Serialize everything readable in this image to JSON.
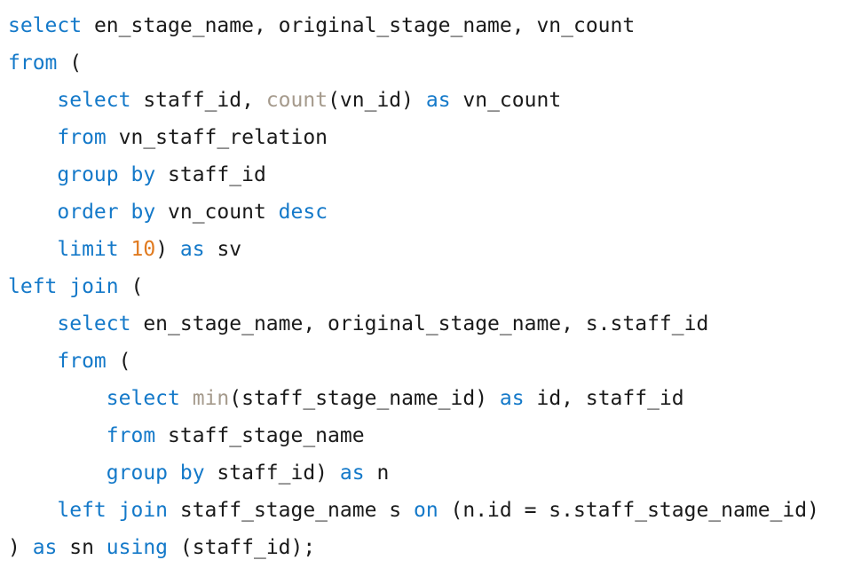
{
  "editor": {
    "lines": [
      [
        {
          "t": "select",
          "k": "keyword"
        },
        {
          "t": " en_stage_name, original_stage_name, vn_count",
          "k": "plain"
        }
      ],
      [
        {
          "t": "from",
          "k": "keyword"
        },
        {
          "t": " (",
          "k": "plain"
        }
      ],
      [
        {
          "t": "    ",
          "k": "plain"
        },
        {
          "t": "select",
          "k": "keyword"
        },
        {
          "t": " staff_id, ",
          "k": "plain"
        },
        {
          "t": "count",
          "k": "func"
        },
        {
          "t": "(vn_id) ",
          "k": "plain"
        },
        {
          "t": "as",
          "k": "keyword"
        },
        {
          "t": " vn_count",
          "k": "plain"
        }
      ],
      [
        {
          "t": "    ",
          "k": "plain"
        },
        {
          "t": "from",
          "k": "keyword"
        },
        {
          "t": " vn_staff_relation",
          "k": "plain"
        }
      ],
      [
        {
          "t": "    ",
          "k": "plain"
        },
        {
          "t": "group by",
          "k": "keyword"
        },
        {
          "t": " staff_id",
          "k": "plain"
        }
      ],
      [
        {
          "t": "    ",
          "k": "plain"
        },
        {
          "t": "order by",
          "k": "keyword"
        },
        {
          "t": " vn_count ",
          "k": "plain"
        },
        {
          "t": "desc",
          "k": "keyword"
        }
      ],
      [
        {
          "t": "    ",
          "k": "plain"
        },
        {
          "t": "limit",
          "k": "keyword"
        },
        {
          "t": " ",
          "k": "plain"
        },
        {
          "t": "10",
          "k": "number"
        },
        {
          "t": ") ",
          "k": "plain"
        },
        {
          "t": "as",
          "k": "keyword"
        },
        {
          "t": " sv",
          "k": "plain"
        }
      ],
      [
        {
          "t": "left join",
          "k": "keyword"
        },
        {
          "t": " (",
          "k": "plain"
        }
      ],
      [
        {
          "t": "    ",
          "k": "plain"
        },
        {
          "t": "select",
          "k": "keyword"
        },
        {
          "t": " en_stage_name, original_stage_name, s.staff_id",
          "k": "plain"
        }
      ],
      [
        {
          "t": "    ",
          "k": "plain"
        },
        {
          "t": "from",
          "k": "keyword"
        },
        {
          "t": " (",
          "k": "plain"
        }
      ],
      [
        {
          "t": "        ",
          "k": "plain"
        },
        {
          "t": "select",
          "k": "keyword"
        },
        {
          "t": " ",
          "k": "plain"
        },
        {
          "t": "min",
          "k": "func"
        },
        {
          "t": "(staff_stage_name_id) ",
          "k": "plain"
        },
        {
          "t": "as",
          "k": "keyword"
        },
        {
          "t": " id, staff_id",
          "k": "plain"
        }
      ],
      [
        {
          "t": "        ",
          "k": "plain"
        },
        {
          "t": "from",
          "k": "keyword"
        },
        {
          "t": " staff_stage_name",
          "k": "plain"
        }
      ],
      [
        {
          "t": "        ",
          "k": "plain"
        },
        {
          "t": "group by",
          "k": "keyword"
        },
        {
          "t": " staff_id) ",
          "k": "plain"
        },
        {
          "t": "as",
          "k": "keyword"
        },
        {
          "t": " n",
          "k": "plain"
        }
      ],
      [
        {
          "t": "    ",
          "k": "plain"
        },
        {
          "t": "left join",
          "k": "keyword"
        },
        {
          "t": " staff_stage_name s ",
          "k": "plain"
        },
        {
          "t": "on",
          "k": "keyword"
        },
        {
          "t": " (n.id = s.staff_stage_name_id)",
          "k": "plain"
        }
      ],
      [
        {
          "t": ") ",
          "k": "plain"
        },
        {
          "t": "as",
          "k": "keyword"
        },
        {
          "t": " sn ",
          "k": "plain"
        },
        {
          "t": "using",
          "k": "keyword"
        },
        {
          "t": " (staff_id);",
          "k": "plain"
        }
      ]
    ]
  }
}
